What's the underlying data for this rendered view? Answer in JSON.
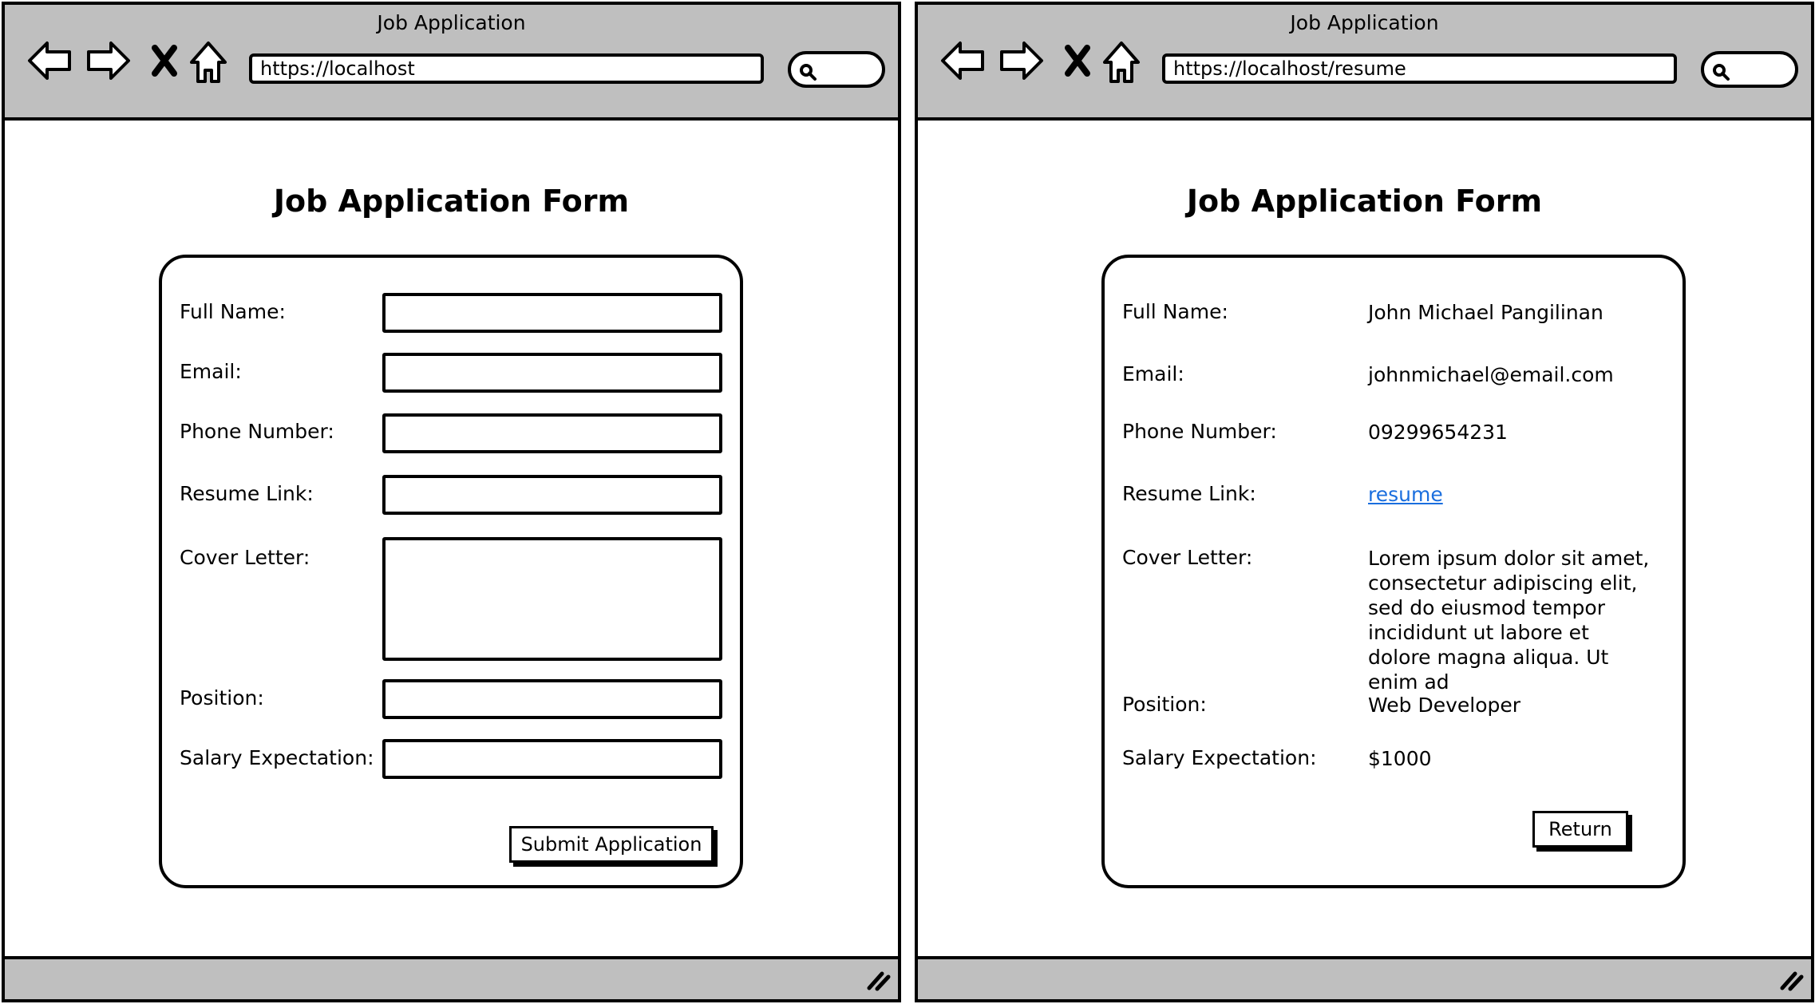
{
  "left_window": {
    "title": "Job Application",
    "url": "https://localhost",
    "form": {
      "title": "Job Application Form",
      "fields": [
        {
          "label": "Full Name:"
        },
        {
          "label": "Email:"
        },
        {
          "label": "Phone Number:"
        },
        {
          "label": "Resume Link:"
        },
        {
          "label": "Cover Letter:"
        },
        {
          "label": "Position:"
        },
        {
          "label": "Salary Expectation:"
        }
      ],
      "submit_label": "Submit Application"
    }
  },
  "right_window": {
    "title": "Job Application",
    "url": "https://localhost/resume",
    "form": {
      "title": "Job Application Form",
      "fields": [
        {
          "label": "Full Name:",
          "value": "John Michael Pangilinan"
        },
        {
          "label": "Email:",
          "value": "johnmichael@email.com"
        },
        {
          "label": "Phone Number:",
          "value": "09299654231"
        },
        {
          "label": "Resume Link:",
          "value": "resume"
        },
        {
          "label": "Cover Letter:",
          "value": "Lorem ipsum dolor sit amet, consectetur adipiscing elit, sed do eiusmod tempor incididunt ut labore et dolore magna aliqua. Ut enim ad"
        },
        {
          "label": "Position:",
          "value": "Web Developer"
        },
        {
          "label": "Salary Expectation:",
          "value": "$1000"
        }
      ],
      "return_label": "Return"
    }
  },
  "icons": [
    "back-arrow-icon",
    "forward-arrow-icon",
    "stop-icon",
    "home-icon",
    "search-icon",
    "resize-grip-icon"
  ],
  "colors": {
    "chrome": "#bfbfbf",
    "link": "#1a6ede",
    "border": "#000000"
  }
}
